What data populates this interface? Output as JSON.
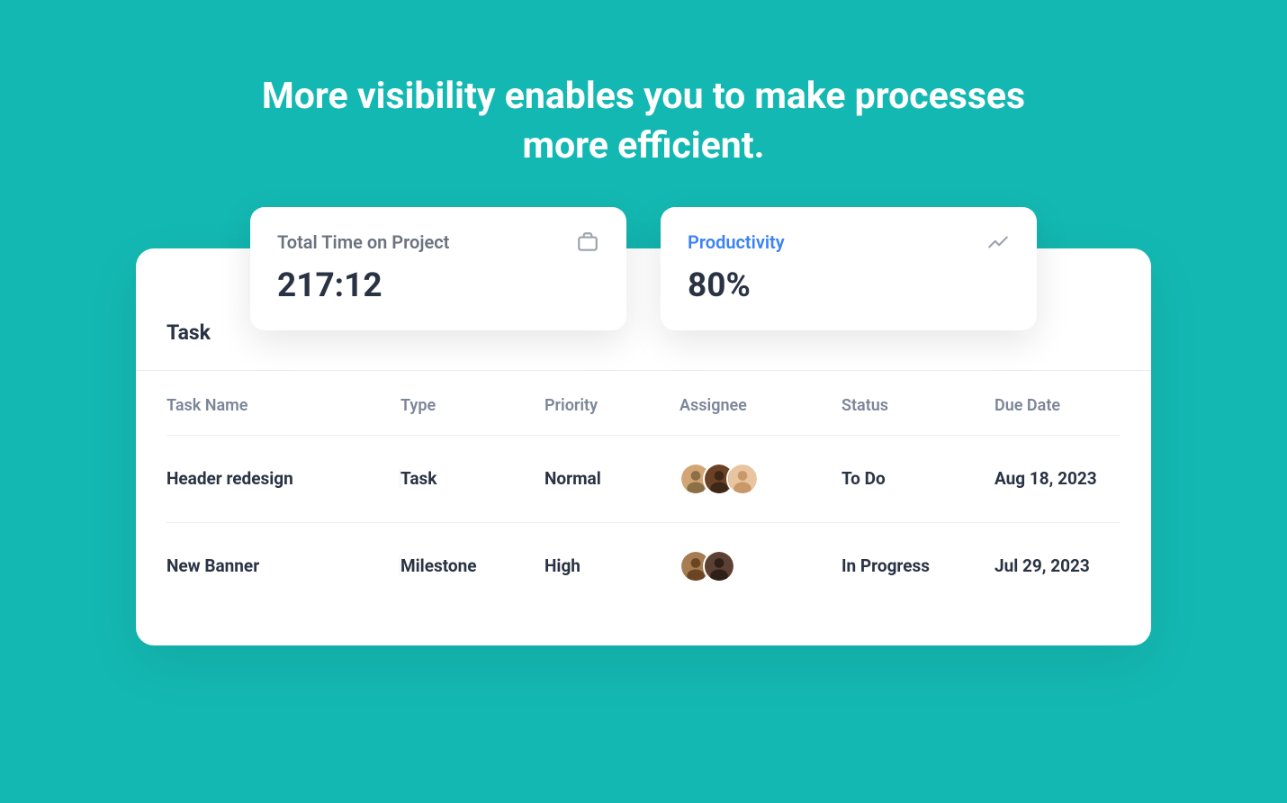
{
  "headline": "More visibility enables you to make processes more efficient.",
  "stats": {
    "total_time": {
      "label": "Total Time on Project",
      "value": "217:12",
      "icon": "briefcase-icon"
    },
    "productivity": {
      "label": "Productivity",
      "value": "80%",
      "icon": "trend-icon"
    }
  },
  "panel": {
    "title": "Task"
  },
  "table": {
    "headers": {
      "name": "Task Name",
      "type": "Type",
      "priority": "Priority",
      "assignee": "Assignee",
      "status": "Status",
      "due_date": "Due Date"
    },
    "rows": [
      {
        "name": "Header redesign",
        "type": "Task",
        "priority": "Normal",
        "assignee_count": 3,
        "status": "To Do",
        "due_date": "Aug 18, 2023"
      },
      {
        "name": "New Banner",
        "type": "Milestone",
        "priority": "High",
        "assignee_count": 2,
        "status": "In Progress",
        "due_date": "Jul 29, 2023"
      }
    ]
  }
}
